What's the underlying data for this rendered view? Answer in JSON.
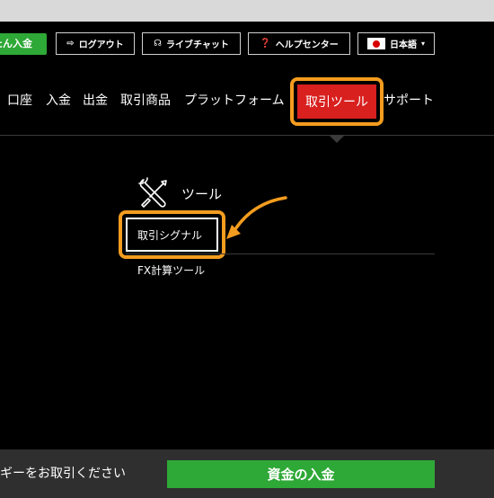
{
  "header": {
    "quick_deposit_label": "かんたん入金",
    "logout_label": "ログアウト",
    "livechat_label": "ライブチャット",
    "helpcenter_label": "ヘルプセンター",
    "language_label": "日本語",
    "language_caret": "▾",
    "logout_icon": "⇨",
    "livechat_icon": "☊",
    "help_icon": "❓"
  },
  "nav": {
    "items": [
      {
        "label": "口座"
      },
      {
        "label": "入金"
      },
      {
        "label": "出金"
      },
      {
        "label": "取引商品"
      },
      {
        "label": "プラットフォーム"
      },
      {
        "label": "取引ツール"
      },
      {
        "label": "サポート"
      }
    ],
    "active_index": 5
  },
  "dropdown": {
    "heading": "ツール",
    "items": [
      {
        "label": "取引シグナル"
      },
      {
        "label": "FX計算ツール"
      }
    ]
  },
  "footer": {
    "text": "ギーをお取引ください",
    "button_label": "資金の入金"
  },
  "colors": {
    "green": "#2ea836",
    "red": "#d8201f",
    "orange_highlight": "#f39c1f",
    "background": "#000000"
  }
}
